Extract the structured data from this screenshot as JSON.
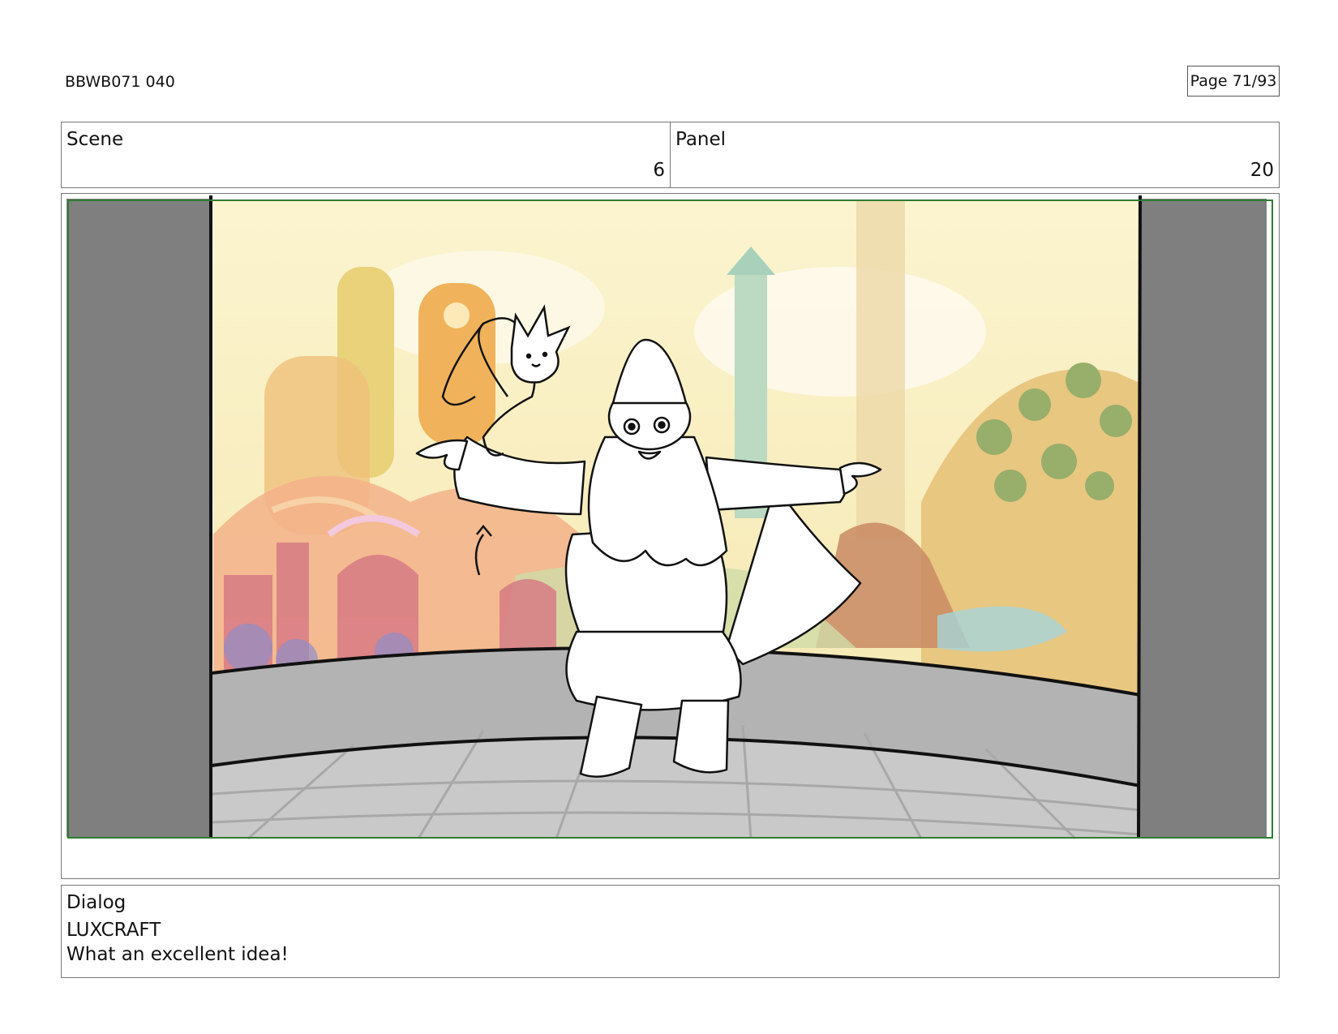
{
  "header": {
    "doc_id": "BBWB071 040",
    "page": "Page 71/93"
  },
  "scene": {
    "label": "Scene",
    "value": "6"
  },
  "panel": {
    "label": "Panel",
    "value": "20"
  },
  "dialog": {
    "label": "Dialog",
    "character": "LUXCRAFT",
    "line": "What an excellent idea!"
  },
  "colors": {
    "safe_frame": "#2e7d32",
    "side_matte": "#7f7f7f",
    "floor": "#c8c8c8",
    "wall": "#b3b3b3"
  }
}
